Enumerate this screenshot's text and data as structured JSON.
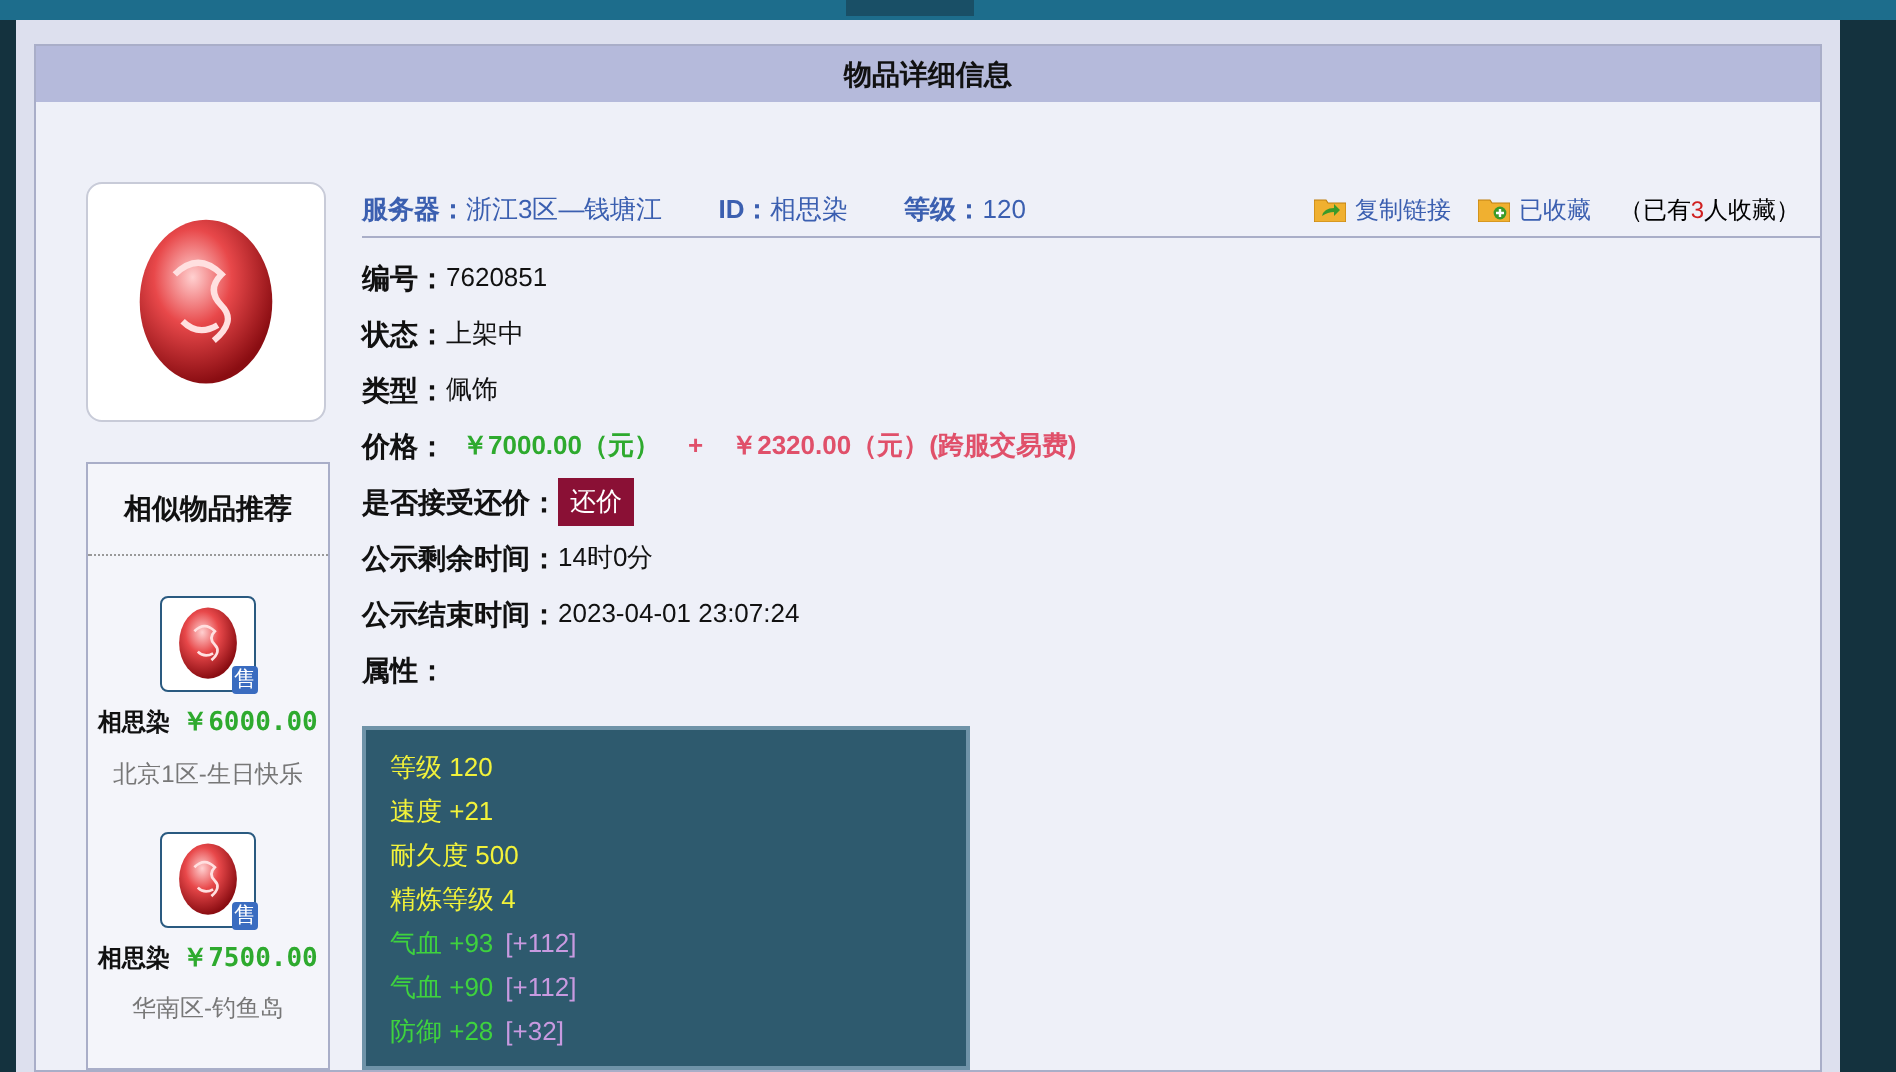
{
  "panel_title": "物品详细信息",
  "item": {
    "header": [
      {
        "label": "服务器：",
        "value": "浙江3区—钱塘江"
      },
      {
        "label": "ID：",
        "value": "相思染"
      },
      {
        "label": "等级：",
        "value": "120"
      }
    ],
    "actions": [
      {
        "kind": "share",
        "label": "复制链接"
      },
      {
        "kind": "favorite",
        "label": "已收藏"
      }
    ],
    "favorites": {
      "prefix": "（已有",
      "count": "3",
      "suffix": "人收藏）"
    },
    "fields": [
      {
        "kind": "text",
        "label": "编号：",
        "value": "7620851"
      },
      {
        "kind": "text",
        "label": "状态：",
        "value": "上架中"
      },
      {
        "kind": "text",
        "label": "类型：",
        "value": "佩饰"
      },
      {
        "kind": "price",
        "label": "价格：",
        "price": "￥7000.00（元）",
        "plus": "+",
        "fee": "￥2320.00（元）(跨服交易费)"
      },
      {
        "kind": "button",
        "label": "是否接受还价：",
        "button": "还价"
      },
      {
        "kind": "text",
        "label": "公示剩余时间：",
        "value": "14时0分"
      },
      {
        "kind": "text",
        "label": "公示结束时间：",
        "value": "2023-04-01 23:07:24"
      },
      {
        "kind": "text",
        "label": "属性："
      }
    ],
    "attributes": [
      {
        "kind": "base",
        "name": "等级",
        "value": "120"
      },
      {
        "kind": "base",
        "name": "速度",
        "value": "+21"
      },
      {
        "kind": "base",
        "name": "耐久度",
        "value": "500"
      },
      {
        "kind": "base",
        "name": "精炼等级",
        "value": "4"
      },
      {
        "kind": "bonus",
        "name": "气血",
        "value": "+93",
        "extra": "[+112]"
      },
      {
        "kind": "bonus",
        "name": "气血",
        "value": "+90",
        "extra": "[+112]"
      },
      {
        "kind": "bonus",
        "name": "防御",
        "value": "+28",
        "extra": "[+32]"
      }
    ]
  },
  "similar": {
    "title": "相似物品推荐",
    "items": [
      {
        "badge": "售",
        "name": "相思染",
        "price": "￥6000.00",
        "server": "北京1区-生日快乐"
      },
      {
        "badge": "售",
        "name": "相思染",
        "price": "￥7500.00",
        "server": "华南区-钓鱼岛"
      }
    ]
  }
}
